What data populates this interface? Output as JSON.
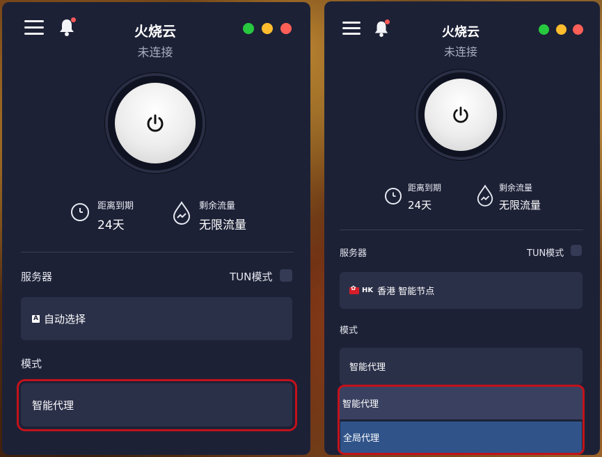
{
  "left": {
    "app_title": "火烧云",
    "status": "未连接",
    "expiry_label": "距离到期",
    "expiry_value": "24天",
    "traffic_label": "剩余流量",
    "traffic_value": "无限流量",
    "server_label": "服务器",
    "tun_label": "TUN模式",
    "server_value": "自动选择",
    "server_badge": "A",
    "mode_label": "模式",
    "mode_value": "智能代理"
  },
  "right": {
    "app_title": "火烧云",
    "status": "未连接",
    "expiry_label": "距离到期",
    "expiry_value": "24天",
    "traffic_label": "剩余流量",
    "traffic_value": "无限流量",
    "server_label": "服务器",
    "tun_label": "TUN模式",
    "server_code": "HK",
    "server_value": "香港 智能节点",
    "mode_label": "模式",
    "mode_value": "智能代理",
    "mode_options": [
      "智能代理",
      "全局代理"
    ]
  },
  "colors": {
    "panel_bg": "#1d2136",
    "field_bg": "#2b3049",
    "highlight": "#c3121b",
    "light_green": "#27c93f",
    "light_yellow": "#ffbd2e",
    "light_red": "#ff5f57",
    "option_selected": "#30548a",
    "option_hover": "#3a4060"
  },
  "icons": [
    "menu-icon",
    "bell-icon",
    "power-icon",
    "clock-icon",
    "drop-icon"
  ]
}
